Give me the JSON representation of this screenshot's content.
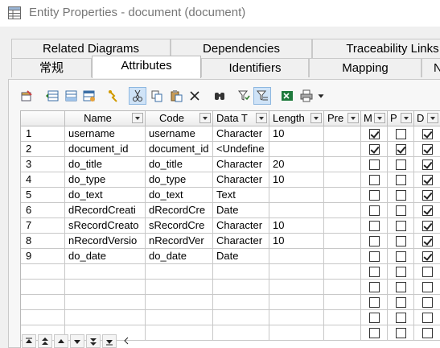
{
  "window": {
    "title": "Entity Properties - document (document)"
  },
  "tabs_back": [
    "Related Diagrams",
    "Dependencies",
    "Traceability Links"
  ],
  "tabs_front": [
    "常规",
    "Attributes",
    "Identifiers",
    "Mapping",
    "N"
  ],
  "active_tab": "Attributes",
  "toolbar": {
    "icons": [
      "properties-icon",
      "insert-row-icon",
      "add-row-icon",
      "add-attributes-icon",
      "find-icon",
      "cut-icon",
      "copy-icon",
      "paste-icon",
      "delete-icon",
      "binoculars-icon",
      "filter-icon",
      "customize-columns-icon",
      "excel-export-icon",
      "print-icon",
      "dropdown-arrow-icon"
    ]
  },
  "columns": {
    "name": "Name",
    "code": "Code",
    "datatype": "Data T",
    "length": "Length",
    "precision": "Pre",
    "mandatory": "M",
    "primary": "P",
    "displayed": "D"
  },
  "rows": [
    {
      "num": "1",
      "name": "username",
      "code": "username",
      "datatype": "Character",
      "length": "10",
      "m": true,
      "p": false,
      "d": true
    },
    {
      "num": "2",
      "name": "document_id",
      "code": "document_id",
      "datatype": "<Undefine",
      "length": "",
      "m": true,
      "p": true,
      "d": true
    },
    {
      "num": "3",
      "name": "do_title",
      "code": "do_title",
      "datatype": "Character",
      "length": "20",
      "m": false,
      "p": false,
      "d": true
    },
    {
      "num": "4",
      "name": "do_type",
      "code": "do_type",
      "datatype": "Character",
      "length": "10",
      "m": false,
      "p": false,
      "d": true
    },
    {
      "num": "5",
      "name": "do_text",
      "code": "do_text",
      "datatype": "Text",
      "length": "",
      "m": false,
      "p": false,
      "d": true
    },
    {
      "num": "6",
      "name": "dRecordCreati",
      "code": "dRecordCre",
      "datatype": "Date",
      "length": "",
      "m": false,
      "p": false,
      "d": true
    },
    {
      "num": "7",
      "name": "sRecordCreato",
      "code": "sRecordCre",
      "datatype": "Character",
      "length": "10",
      "m": false,
      "p": false,
      "d": true
    },
    {
      "num": "8",
      "name": "nRecordVersio",
      "code": "nRecordVer",
      "datatype": "Character",
      "length": "10",
      "m": false,
      "p": false,
      "d": true
    },
    {
      "num": "9",
      "name": "do_date",
      "code": "do_date",
      "datatype": "Date",
      "length": "",
      "m": false,
      "p": false,
      "d": true
    }
  ],
  "empty_rows": 5,
  "navigation": [
    "first-icon",
    "page-up-icon",
    "up-icon",
    "down-icon",
    "page-down-icon",
    "last-icon",
    "scroll-left-icon"
  ]
}
